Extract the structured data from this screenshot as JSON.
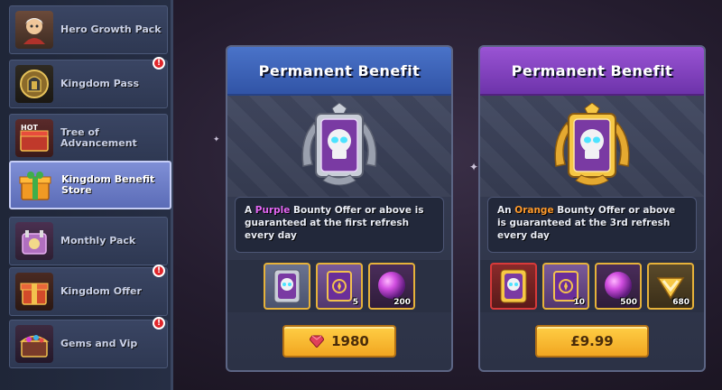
{
  "sidebar": {
    "items": [
      {
        "label": "Hero Growth Pack",
        "icon": "hero-portrait-icon",
        "alert": false,
        "active": false
      },
      {
        "label": "Kingdom Pass",
        "icon": "helmet-emblem-icon",
        "alert": true,
        "active": false
      },
      {
        "label": "Tree of Advancement",
        "icon": "tree-chest-icon",
        "alert": false,
        "active": false,
        "badge": "HOT"
      },
      {
        "label": "Kingdom Benefit Store",
        "icon": "gift-box-icon",
        "alert": false,
        "active": true
      },
      {
        "label": "Monthly Pack",
        "icon": "monthly-gift-icon",
        "alert": false,
        "active": false
      },
      {
        "label": "Kingdom Offer",
        "icon": "red-gift-icon",
        "alert": true,
        "active": false
      },
      {
        "label": "Gems and Vip",
        "icon": "treasure-chest-icon",
        "alert": true,
        "active": false
      }
    ],
    "alert_mark": "!"
  },
  "cards": [
    {
      "header": "Permanent Benefit",
      "tier": "silver",
      "description_prefix": "A ",
      "description_highlight": "Purple",
      "description_suffix": " Bounty Offer or above is guaranteed at the first refresh every day",
      "rewards": [
        {
          "icon": "silver-skull-emblem-icon",
          "qty": ""
        },
        {
          "icon": "spell-book-icon",
          "qty": "5"
        },
        {
          "icon": "purple-orb-icon",
          "qty": "200"
        }
      ],
      "price": "1980",
      "price_icon": "ruby-gem-icon"
    },
    {
      "header": "Permanent Benefit",
      "tier": "gold",
      "description_prefix": "An ",
      "description_highlight": "Orange",
      "description_suffix": " Bounty Offer or above is guaranteed at the 3rd refresh every day",
      "rewards": [
        {
          "icon": "red-skull-emblem-icon",
          "qty": ""
        },
        {
          "icon": "spell-book-icon",
          "qty": "10"
        },
        {
          "icon": "purple-orb-icon",
          "qty": "500"
        },
        {
          "icon": "gold-chevron-gem-icon",
          "qty": "680"
        }
      ],
      "price": "£9.99",
      "price_icon": ""
    }
  ],
  "colors": {
    "purple_highlight": "#e266f2",
    "orange_highlight": "#ff9a2c",
    "button_gold": "#f1a621",
    "alert_red": "#e0262b"
  }
}
